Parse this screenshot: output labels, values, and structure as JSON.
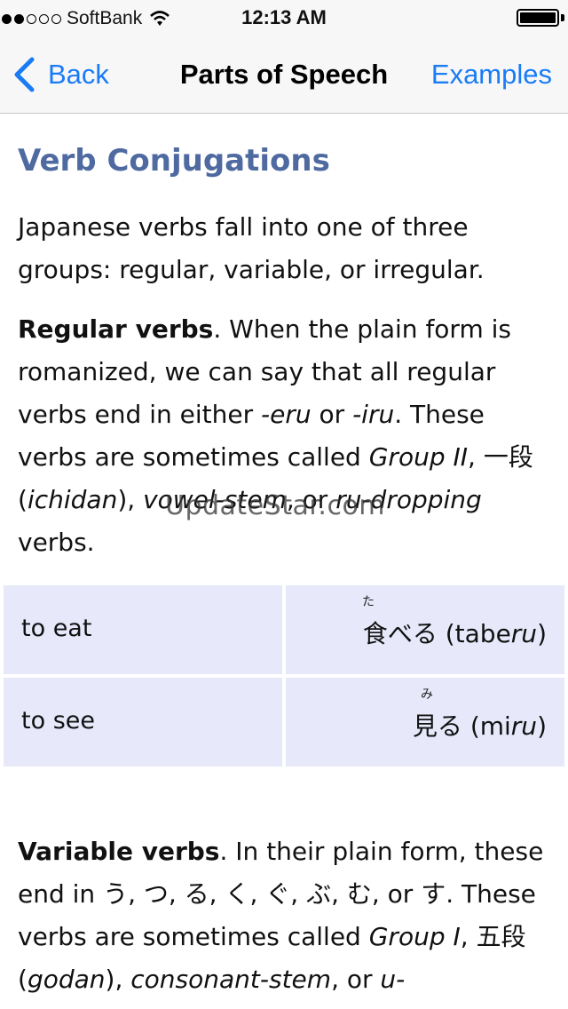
{
  "status_bar": {
    "carrier": "SoftBank",
    "time": "12:13 AM",
    "signal_bars_filled": 2,
    "signal_bars_total": 5,
    "battery_level": 1.0
  },
  "nav": {
    "back_label": "Back",
    "title": "Parts of Speech",
    "right_label": "Examples"
  },
  "content": {
    "heading": "Verb Conjugations",
    "intro": "Japanese verbs fall into one of three groups: regular, variable, or irregular.",
    "regular": {
      "term": "Regular verbs",
      "t1": ". When the plain form is romanized, we can say that all regular verbs end in either ",
      "suffix1": "-eru",
      "t2": " or ",
      "suffix2": "-iru",
      "t3": ". These verbs are sometimes called ",
      "alias1": "Group II",
      "t4": ", 一段 (",
      "alias2": "ichidan",
      "t5": "), ",
      "alias3": "vowel-stem",
      "t6": ", or ",
      "alias4": "ru-dropping",
      "t7": " verbs."
    },
    "examples": [
      {
        "english": "to eat",
        "kanji": "食",
        "kana": "べる",
        "furigana": "た",
        "romaji_prefix": "(tabe",
        "romaji_ending": "ru",
        "romaji_suffix": ")"
      },
      {
        "english": "to see",
        "kanji": "見",
        "kana": "る",
        "furigana": "み",
        "romaji_prefix": "(mi",
        "romaji_ending": "ru",
        "romaji_suffix": ")"
      }
    ],
    "variable": {
      "term": "Variable verbs",
      "t1": ". In their plain form, these end in う, つ, る, く, ぐ, ぶ, む, or す. These verbs are sometimes called ",
      "alias1": "Group I",
      "t2": ", 五段 (",
      "alias2": "godan",
      "t3": "), ",
      "alias3": "consonant-stem",
      "t4": ", or ",
      "alias4": "u-"
    },
    "watermark": "UpdateStar.com"
  },
  "colors": {
    "accent": "#1a7cf5",
    "heading": "#4e6aa0",
    "table_cell": "#e7e9fb",
    "bar_bg": "#f7f7f7"
  }
}
